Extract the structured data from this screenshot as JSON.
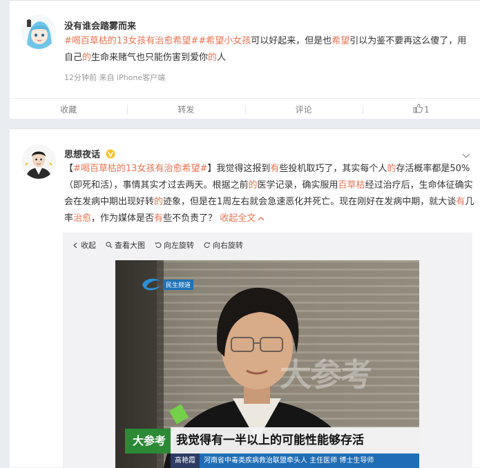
{
  "post1": {
    "username": "没有谁会踏雾而来",
    "text_parts": [
      {
        "t": "#喝百草枯的13女孩有治愈希望#",
        "c": "kw"
      },
      {
        "t": "#希望小女孩",
        "c": "kw"
      },
      {
        "t": "可以好起来，但是也",
        "c": ""
      },
      {
        "t": "希望",
        "c": "hl"
      },
      {
        "t": "引以为鉴不要再这么傻了，用自己",
        "c": ""
      },
      {
        "t": "的",
        "c": "hl"
      },
      {
        "t": "生命来赌气也只能伤害到爱你",
        "c": ""
      },
      {
        "t": "的",
        "c": "hl"
      },
      {
        "t": "人",
        "c": ""
      }
    ],
    "meta": "12分钟前  来自 iPhone客户端",
    "actions": {
      "collect": "收藏",
      "forward": "转发",
      "comment": "评论",
      "like_count": "1"
    }
  },
  "post2": {
    "username": "思想夜话",
    "verified_badge": "V",
    "text_parts": [
      {
        "t": "【",
        "c": ""
      },
      {
        "t": "#喝百草枯的13女孩有治愈希望#",
        "c": "kw"
      },
      {
        "t": "】我觉得这报到",
        "c": ""
      },
      {
        "t": "有",
        "c": "hl"
      },
      {
        "t": "些投机取巧了，其实每个人",
        "c": ""
      },
      {
        "t": "的",
        "c": "hl"
      },
      {
        "t": "存活概率都是50%（即死和活），事情其实才过去两天。根据之前",
        "c": ""
      },
      {
        "t": "的",
        "c": "hl"
      },
      {
        "t": "医学记录，确实服用",
        "c": ""
      },
      {
        "t": "百草枯",
        "c": "hl"
      },
      {
        "t": "经过治疗后，生命体征确实会在发病中期出现好转",
        "c": ""
      },
      {
        "t": "的",
        "c": "hl"
      },
      {
        "t": "迹象，但是在1周左右就会急速恶化并死亡。现在刚好在发病中期，就大谈",
        "c": ""
      },
      {
        "t": "有",
        "c": "hl"
      },
      {
        "t": "几率",
        "c": ""
      },
      {
        "t": "治愈",
        "c": "hl"
      },
      {
        "t": "，作为媒体是否",
        "c": ""
      },
      {
        "t": "有",
        "c": "hl"
      },
      {
        "t": "些不负责了？ ",
        "c": ""
      }
    ],
    "collapse_label": "收起全文",
    "media_toolbar": {
      "collapse": "收起",
      "view_large": "查看大图",
      "rotate_left": "向左旋转",
      "rotate_right": "向右旋转"
    },
    "video": {
      "channel_logo_text": "民生频道",
      "watermark": "大参考",
      "subtitle": "我觉得有一半以上的可能性能够存活",
      "person_name": "高艳霞",
      "person_title": "河南省中毒类疾病救治联盟牵头人  主任医师  博士生导师",
      "corner_logo": "大参考"
    }
  },
  "colors": {
    "accent": "#eb7350",
    "background": "#e9ecf0"
  }
}
